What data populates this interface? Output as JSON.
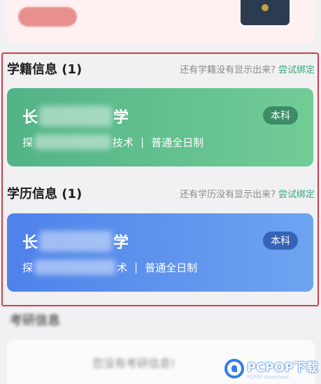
{
  "top_banner": {
    "button_label": ""
  },
  "xueji": {
    "title": "学籍信息 (1)",
    "prompt": "还有学籍没有显示出来?",
    "link": "尝试绑定",
    "card": {
      "name_start": "长",
      "name_end": "学",
      "meta_start": "探",
      "meta_end": "技术",
      "separator": "|",
      "mode": "普通全日制",
      "badge": "本科",
      "color": "#5ab88a"
    }
  },
  "xueli": {
    "title": "学历信息 (1)",
    "prompt": "还有学历没有显示出来?",
    "link": "尝试绑定",
    "card": {
      "name_start": "长",
      "name_end": "学",
      "meta_start": "探",
      "meta_end": "术",
      "separator": "|",
      "mode": "普通全日制",
      "badge": "本科",
      "color": "#5b8ff0"
    }
  },
  "kaoyan": {
    "title": "考研信息",
    "empty_text": "您没有考研信息!"
  },
  "watermark": {
    "main": "PCPOP下载",
    "sub": "PCPOP Download"
  },
  "highlight_color": "#d23c4a"
}
